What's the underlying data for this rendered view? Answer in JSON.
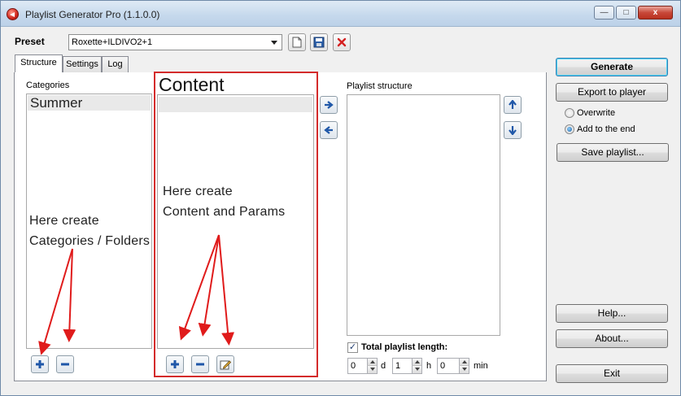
{
  "window": {
    "title": "Playlist Generator Pro (1.1.0.0)",
    "minimize_label": "—",
    "maximize_label": "□",
    "close_label": "x"
  },
  "preset": {
    "label": "Preset",
    "selected": "Roxette+ILDIVO2+1"
  },
  "tabs": [
    {
      "label": "Structure",
      "active": true
    },
    {
      "label": "Settings",
      "active": false
    },
    {
      "label": "Log",
      "active": false
    }
  ],
  "categories": {
    "label": "Categories",
    "items": [
      "Summer"
    ],
    "annotation_line1": "Here create",
    "annotation_line2": "Categories / Folders"
  },
  "content": {
    "title": "Content",
    "annotation_line1": "Here create",
    "annotation_line2": "Content and Params"
  },
  "playlist_structure": {
    "label": "Playlist structure"
  },
  "total_length": {
    "label": "Total playlist length:",
    "checked": true,
    "days": "0",
    "days_unit": "d",
    "hours": "1",
    "hours_unit": "h",
    "minutes": "0",
    "minutes_unit": "min"
  },
  "right_panel": {
    "generate": "Generate",
    "export": "Export to player",
    "overwrite": "Overwrite",
    "add_to_end": "Add to the end",
    "selected_mode": "add_to_end",
    "save_playlist": "Save playlist...",
    "help": "Help...",
    "about": "About...",
    "exit": "Exit"
  },
  "colors": {
    "annotation_red": "#d42b2b",
    "accent_blue": "#2c5fa8"
  }
}
